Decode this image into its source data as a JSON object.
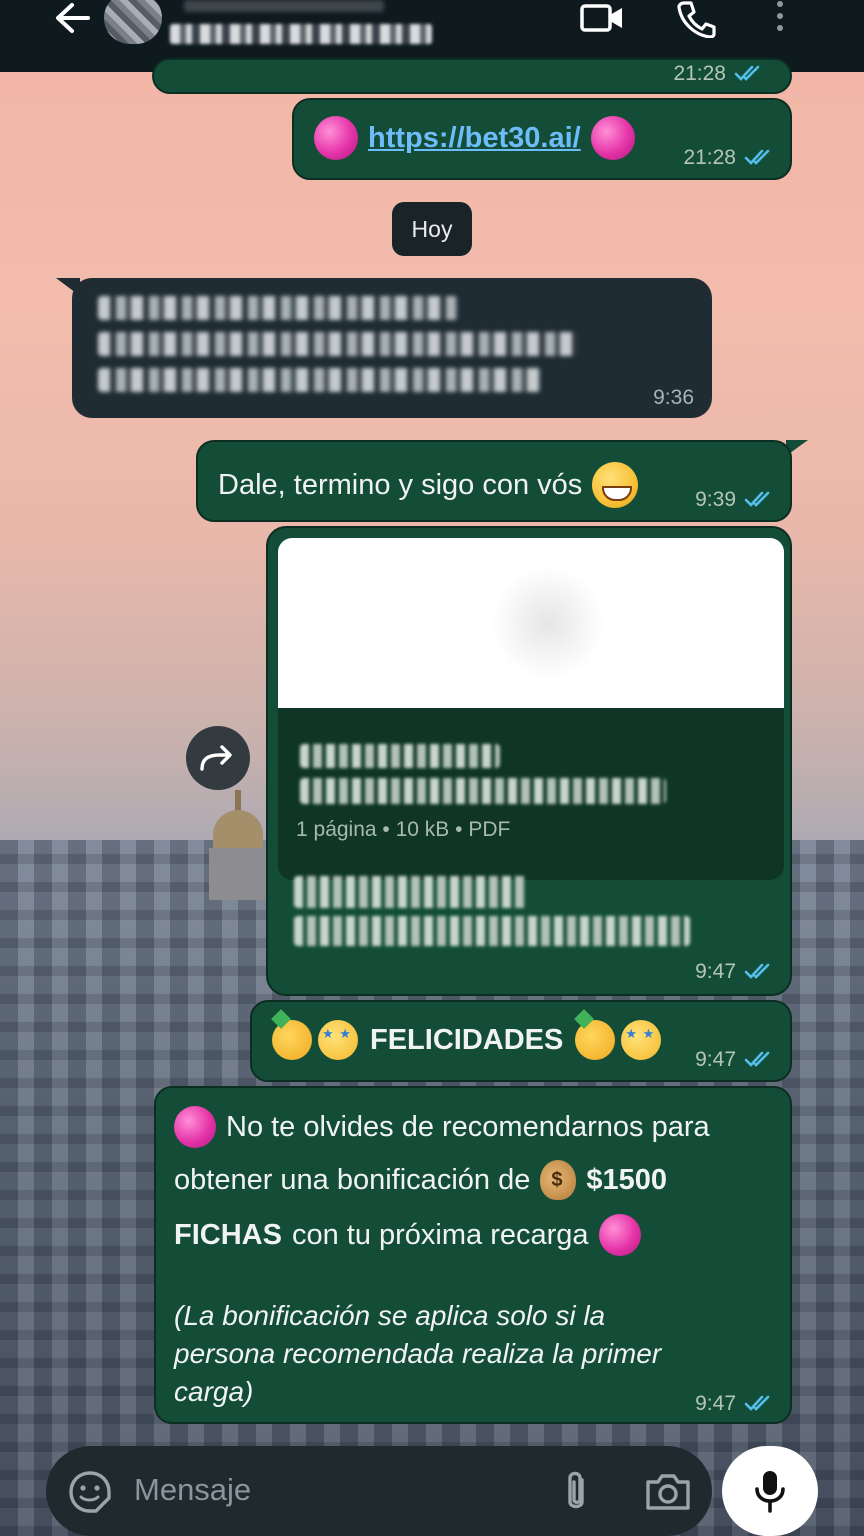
{
  "header": {
    "back_icon": "arrow-left-icon",
    "video_call_icon": "video-icon",
    "voice_call_icon": "phone-icon",
    "more_icon": "more-vertical-icon"
  },
  "messages": {
    "partial_top": {
      "time": "21:28"
    },
    "link": {
      "url": "https://bet30.ai/",
      "time": "21:28"
    },
    "date_chip": "Hoy",
    "incoming": {
      "time": "9:36"
    },
    "dale": {
      "text": "Dale, termino y sigo con vós",
      "time": "9:39"
    },
    "document": {
      "meta": "1 página • 10 kB • PDF",
      "time": "9:47"
    },
    "felicidades": {
      "text": "FELICIDADES",
      "time": "9:47"
    },
    "promo": {
      "line1": "No te olvides de recomendarnos para",
      "line2_a": "obtener una bonificación de",
      "line2_b": "$1500",
      "line3_a": "FICHAS",
      "line3_b": "con tu próxima recarga",
      "note1": "(La bonificación se aplica solo si la",
      "note2": "persona recomendada realiza la primer",
      "note3": "carga)",
      "time": "9:47"
    }
  },
  "composer": {
    "placeholder": "Mensaje"
  },
  "colors": {
    "outgoing_bubble": "#134d37",
    "incoming_bubble": "#1f2c33",
    "link": "#6ebdfa",
    "read_ticks": "#53bdeb"
  }
}
